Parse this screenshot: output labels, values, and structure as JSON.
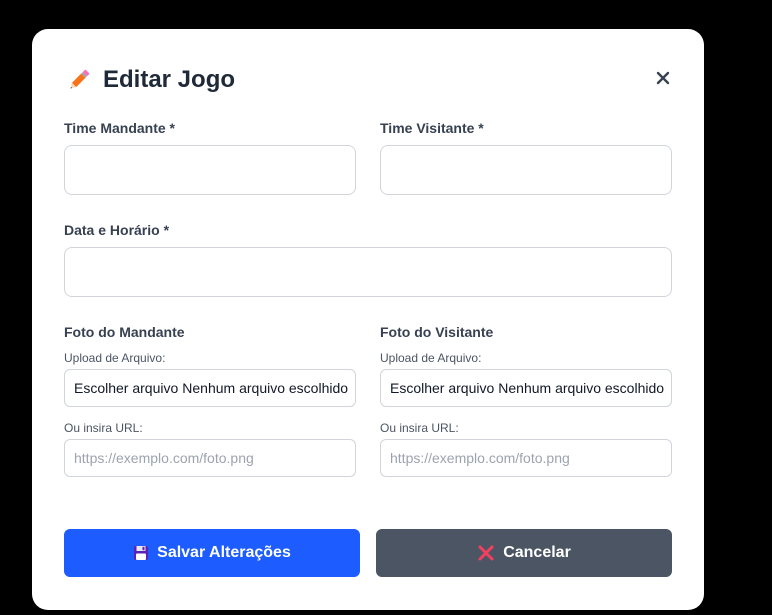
{
  "modal": {
    "title": "Editar Jogo",
    "title_icon": "pencil-icon",
    "close_icon": "close-icon"
  },
  "form": {
    "home_team_label": "Time Mandante *",
    "home_team_value": "",
    "away_team_label": "Time Visitante *",
    "away_team_value": "",
    "datetime_label": "Data e Horário *",
    "datetime_value": "",
    "home_photo": {
      "label": "Foto do Mandante",
      "upload_label": "Upload de Arquivo:",
      "file_button": "Escolher arquivo",
      "file_status": "Nenhum arquivo escolhido",
      "url_label": "Ou insira URL:",
      "url_placeholder": "https://exemplo.com/foto.png"
    },
    "away_photo": {
      "label": "Foto do Visitante",
      "upload_label": "Upload de Arquivo:",
      "file_button": "Escolher arquivo",
      "file_status": "Nenhum arquivo escolhido",
      "url_label": "Ou insira URL:",
      "url_placeholder": "https://exemplo.com/foto.png"
    }
  },
  "actions": {
    "save_label": "Salvar Alterações",
    "save_icon": "floppy-disk-icon",
    "cancel_label": "Cancelar",
    "cancel_icon": "cross-mark-icon"
  },
  "colors": {
    "save_button": "#1d5cff",
    "cancel_button": "#4b5563",
    "backdrop": "#000000"
  }
}
